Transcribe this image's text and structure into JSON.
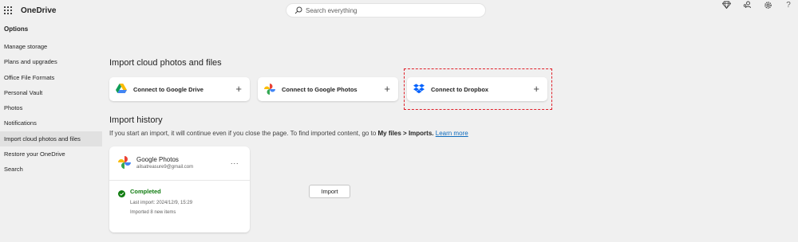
{
  "app": {
    "title": "OneDrive"
  },
  "search": {
    "placeholder": "Search everything"
  },
  "top_icons": [
    "diamond-icon",
    "people-icon",
    "gear-icon",
    "help-icon"
  ],
  "help_glyph": "?",
  "sidebar": {
    "heading": "Options",
    "items": [
      {
        "label": "Manage storage"
      },
      {
        "label": "Plans and upgrades"
      },
      {
        "label": "Office File Formats"
      },
      {
        "label": "Personal Vault"
      },
      {
        "label": "Photos"
      },
      {
        "label": "Notifications"
      },
      {
        "label": "Import cloud photos and files",
        "active": true
      },
      {
        "label": "Restore your OneDrive"
      },
      {
        "label": "Search"
      }
    ]
  },
  "main": {
    "import_title": "Import cloud photos and files",
    "connectors": [
      {
        "label": "Connect to Google Drive",
        "icon": "google-drive-icon",
        "action": "+"
      },
      {
        "label": "Connect to Google Photos",
        "icon": "google-photos-icon",
        "action": "+"
      },
      {
        "label": "Connect to Dropbox",
        "icon": "dropbox-icon",
        "action": "+"
      }
    ],
    "history_title": "Import history",
    "history_desc_prefix": "If you start an import, it will continue even if you close the page. To find imported content, go to ",
    "history_desc_bold": "My files > Imports.",
    "history_desc_link": "Learn more",
    "history_card": {
      "service": "Google Photos",
      "email": "ailsatreasure9@gmail.com",
      "more": "...",
      "status": "Completed",
      "button": "Import",
      "last_import": "Last import: 2024/12/9, 15:29",
      "imported": "Imported 8 new items"
    }
  },
  "colors": {
    "accent": "#0f6cbd",
    "status_green": "#107c10",
    "highlight_red": "#e0202a",
    "dropbox_blue": "#0061fe"
  }
}
